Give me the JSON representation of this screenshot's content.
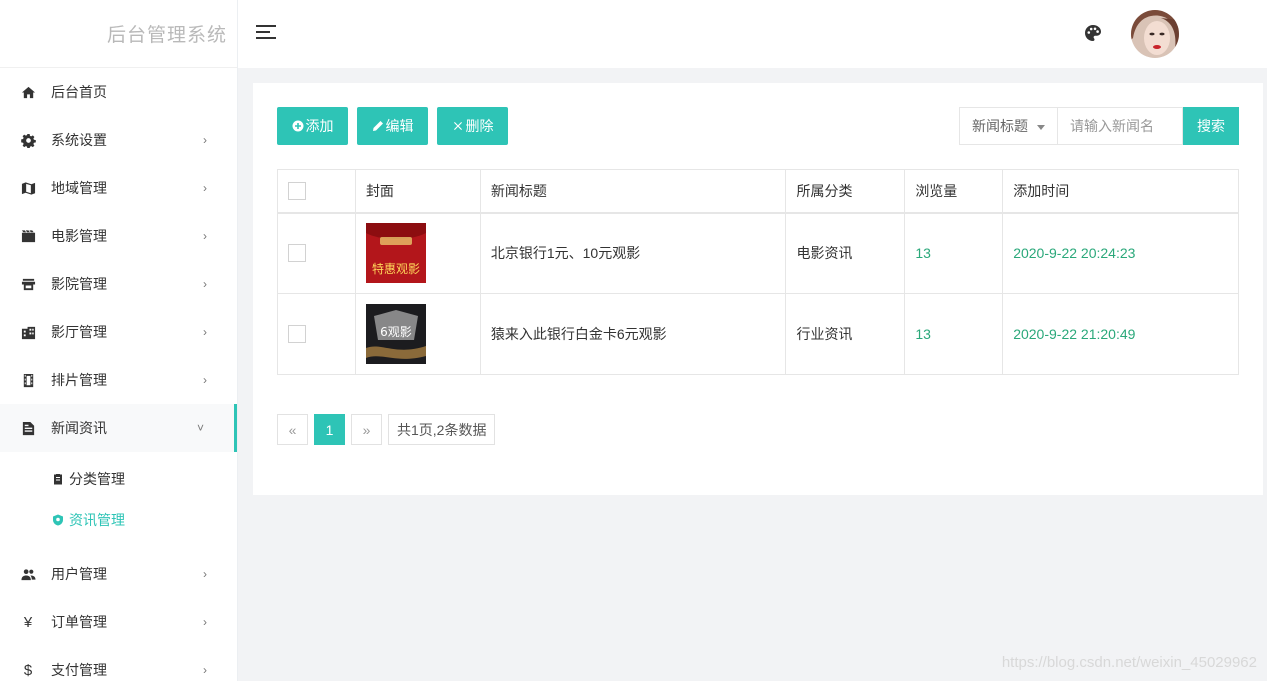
{
  "app": {
    "title": "后台管理系统"
  },
  "colors": {
    "accent": "#2ec4b6",
    "green_text": "#2aa87a"
  },
  "sidebar": {
    "items": [
      {
        "label": "后台首页",
        "icon": "home-icon"
      },
      {
        "label": "系统设置",
        "icon": "gear-icon",
        "arrow": "›"
      },
      {
        "label": "地域管理",
        "icon": "map-icon",
        "arrow": "›"
      },
      {
        "label": "电影管理",
        "icon": "film-icon",
        "arrow": "›"
      },
      {
        "label": "影院管理",
        "icon": "store-icon",
        "arrow": "›"
      },
      {
        "label": "影厅管理",
        "icon": "building-icon",
        "arrow": "›"
      },
      {
        "label": "排片管理",
        "icon": "film-strip-icon",
        "arrow": "›"
      },
      {
        "label": "新闻资讯",
        "icon": "document-icon",
        "arrow": "˅"
      },
      {
        "label": "用户管理",
        "icon": "users-icon",
        "arrow": "›"
      },
      {
        "label": "订单管理",
        "icon": "yen-icon",
        "symbol": "¥",
        "arrow": "›"
      },
      {
        "label": "支付管理",
        "icon": "dollar-icon",
        "symbol": "$",
        "arrow": "›"
      }
    ],
    "sub_items": [
      {
        "label": "分类管理",
        "icon": "clipboard-icon"
      },
      {
        "label": "资讯管理",
        "icon": "shield-icon"
      }
    ]
  },
  "toolbar": {
    "add_label": "添加",
    "edit_label": "编辑",
    "delete_label": "删除"
  },
  "search": {
    "field_label": "新闻标题",
    "placeholder": "请输入新闻名",
    "button_label": "搜索"
  },
  "table": {
    "headers": [
      "封面",
      "新闻标题",
      "所属分类",
      "浏览量",
      "添加时间"
    ],
    "rows": [
      {
        "title": "北京银行1元、10元观影",
        "category": "电影资讯",
        "views": "13",
        "added": "2020-9-22 20:24:23",
        "cover_text": "特惠观影"
      },
      {
        "title": "猿来入此银行白金卡6元观影",
        "category": "行业资讯",
        "views": "13",
        "added": "2020-9-22 21:20:49",
        "cover_text": "6观影"
      }
    ]
  },
  "pager": {
    "prev": "«",
    "current": "1",
    "next": "»",
    "info": "共1页,2条数据"
  },
  "watermark": "https://blog.csdn.net/weixin_45029962"
}
